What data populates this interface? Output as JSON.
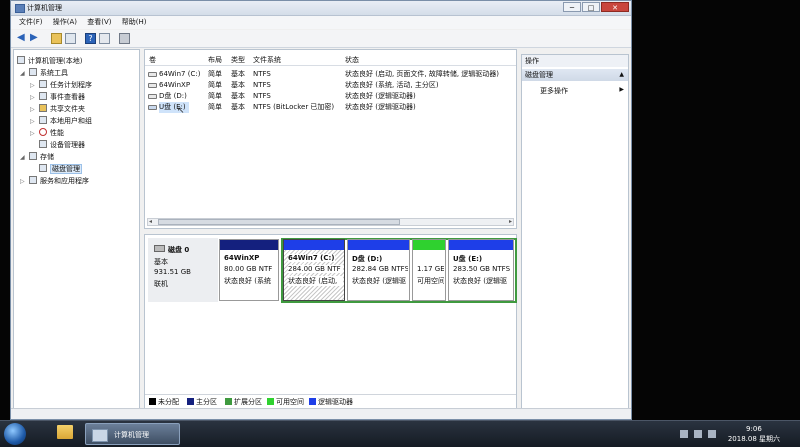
{
  "window": {
    "title": "计算机管理",
    "minimize": "─",
    "maximize": "□",
    "close": "✕"
  },
  "menu": [
    "文件(F)",
    "操作(A)",
    "查看(V)",
    "帮助(H)"
  ],
  "tree": {
    "root": "计算机管理(本地)",
    "system_tools": "系统工具",
    "task_scheduler": "任务计划程序",
    "event_viewer": "事件查看器",
    "shared_folders": "共享文件夹",
    "local_users": "本地用户和组",
    "performance": "性能",
    "device_manager": "设备管理器",
    "storage": "存储",
    "disk_management": "磁盘管理",
    "services": "服务和应用程序"
  },
  "volumes": {
    "headers": [
      "卷",
      "布局",
      "类型",
      "文件系统",
      "状态"
    ],
    "rows": [
      {
        "name": "64Win7 (C:)",
        "layout": "简单",
        "type": "基本",
        "fs": "NTFS",
        "status": "状态良好 (启动, 页面文件, 故障转储, 逻辑驱动器)"
      },
      {
        "name": "64WinXP",
        "layout": "简单",
        "type": "基本",
        "fs": "NTFS",
        "status": "状态良好 (系统, 活动, 主分区)"
      },
      {
        "name": "D盘 (D:)",
        "layout": "简单",
        "type": "基本",
        "fs": "NTFS",
        "status": "状态良好 (逻辑驱动器)"
      },
      {
        "name": "U盘 (E:)",
        "layout": "简单",
        "type": "基本",
        "fs": "NTFS (BitLocker 已加密)",
        "status": "状态良好 (逻辑驱动器)"
      }
    ]
  },
  "disk": {
    "name": "磁盘 0",
    "type": "基本",
    "size": "931.51 GB",
    "state": "联机",
    "partitions": [
      {
        "name": "64WinXP",
        "size": "80.00 GB NTF",
        "status": "状态良好 (系统"
      },
      {
        "name": "64Win7  (C:)",
        "size": "284.00 GB NTF",
        "status": "状态良好 (启动,"
      },
      {
        "name": "D盘  (D:)",
        "size": "282.84 GB NTFS",
        "status": "状态良好 (逻辑驱"
      },
      {
        "name": "",
        "size": "1.17 GE",
        "status": "可用空间"
      },
      {
        "name": "U盘  (E:)",
        "size": "283.50 GB NTFS",
        "status": "状态良好 (逻辑驱"
      }
    ]
  },
  "legend": [
    "未分配",
    "主分区",
    "扩展分区",
    "可用空间",
    "逻辑驱动器"
  ],
  "actions": {
    "title": "操作",
    "section": "磁盘管理",
    "more": "更多操作"
  },
  "taskbar": {
    "active_label": "计算机管理",
    "time": "9:06",
    "date": "2018.08 星期六"
  },
  "colors": {
    "primary": "#14207e",
    "logical": "#1e3ee8",
    "free": "#2fd12f",
    "extended": "#3f9a3f",
    "unallocated": "#000000"
  }
}
